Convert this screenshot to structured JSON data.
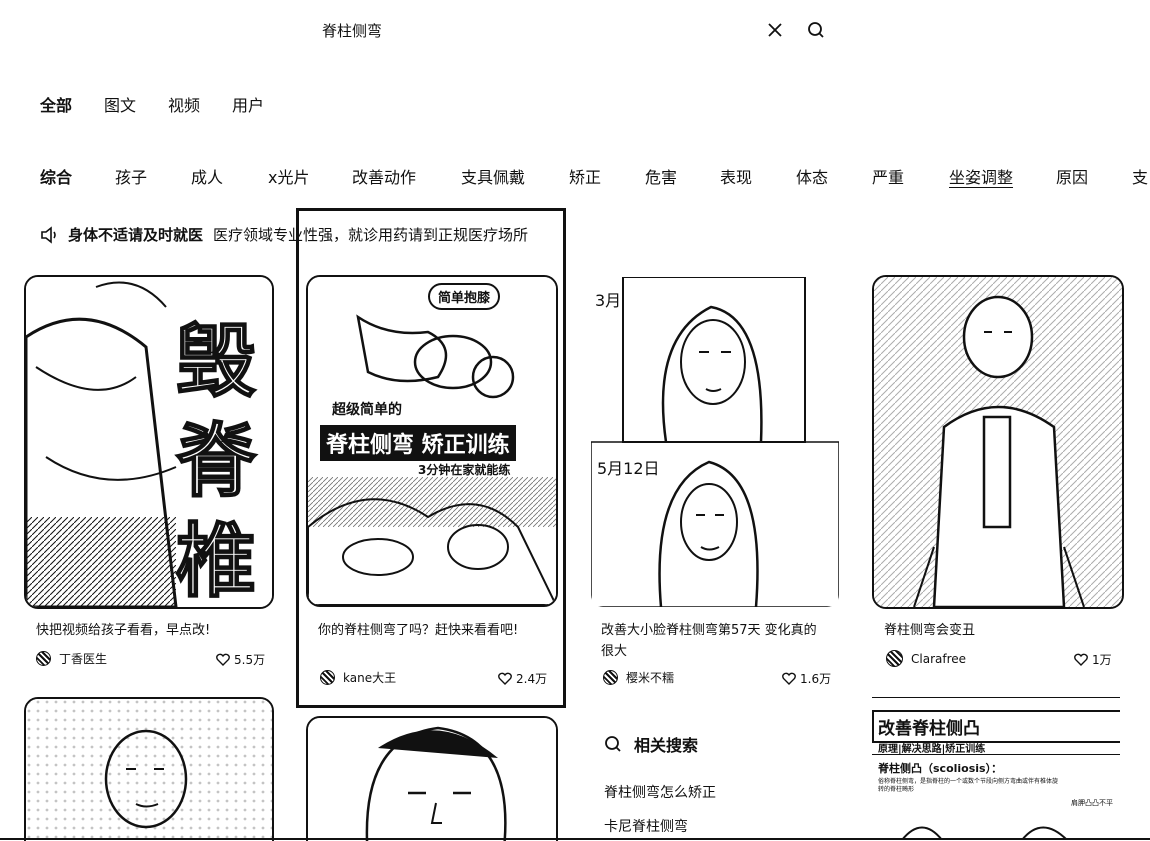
{
  "search": {
    "query": "脊柱侧弯"
  },
  "type_tabs": [
    "全部",
    "图文",
    "视频",
    "用户"
  ],
  "topic_tabs": [
    "综合",
    "孩子",
    "成人",
    "x光片",
    "改善动作",
    "支具佩戴",
    "矫正",
    "危害",
    "表现",
    "体态",
    "严重",
    "坐姿调整",
    "原因",
    "支"
  ],
  "notice": {
    "bold": "身体不适请及时就医",
    "text": "医疗领域专业性强，就诊用药请到正规医疗场所"
  },
  "cards": [
    {
      "title": "快把视频给孩子看看，早点改!",
      "author": "丁香医生",
      "likes": "5.5万",
      "cover_text": [
        "毁",
        "脊",
        "椎"
      ]
    },
    {
      "title": "你的脊柱侧弯了吗？赶快来看看吧!",
      "author": "kane大王",
      "likes": "2.4万",
      "cover_text": [
        "简单抱膝",
        "超级简单的",
        "脊柱侧弯 矫正训练",
        "3分钟在家就能练"
      ]
    },
    {
      "title": "改善大小脸脊柱侧弯第57天 变化真的很大",
      "author": "樱米不糯",
      "likes": "1.6万",
      "cover_text": [
        "3月",
        "5月12日"
      ]
    },
    {
      "title": "脊柱侧弯会变丑",
      "author": "Clarafree",
      "likes": "1万"
    }
  ],
  "second_row": {
    "card4_cover": {
      "heading": "改善脊柱侧凸",
      "subheading": "原理|解决思路|矫正训练",
      "term": "脊柱侧凸（scoliosis）：",
      "body": "俗称脊柱侧弯，是指脊柱的一个或数个节段向侧方弯曲或伴有椎体旋转的脊柱畸形",
      "note": "肩胛凸凸不平"
    }
  },
  "related": {
    "heading": "相关搜索",
    "items": [
      "脊柱侧弯怎么矫正",
      "卡尼脊柱侧弯"
    ]
  }
}
